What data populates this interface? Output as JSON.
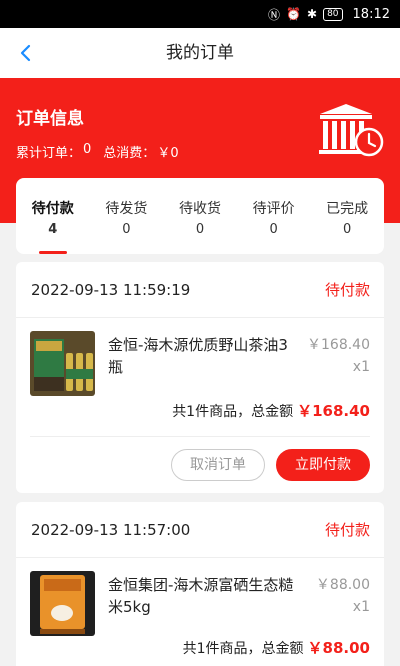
{
  "status_bar": {
    "battery": "80",
    "time": "18:12"
  },
  "nav": {
    "title": "我的订单"
  },
  "summary_header": {
    "title": "订单信息",
    "total_orders_label": "累计订单：",
    "total_orders_value": "0",
    "total_spend_label": "总消费：",
    "total_spend_value": "￥0"
  },
  "tabs": [
    {
      "label": "待付款",
      "count": "4",
      "active": true
    },
    {
      "label": "待发货",
      "count": "0",
      "active": false
    },
    {
      "label": "待收货",
      "count": "0",
      "active": false
    },
    {
      "label": "待评价",
      "count": "0",
      "active": false
    },
    {
      "label": "已完成",
      "count": "0",
      "active": false
    }
  ],
  "orders": [
    {
      "datetime": "2022-09-13 11:59:19",
      "status": "待付款",
      "product_name": "金恒-海木源优质野山茶油3瓶",
      "price": "￥168.40",
      "qty": "x1",
      "summary_text": "共1件商品，总金额",
      "total": "￥168.40",
      "cancel_label": "取消订单",
      "pay_label": "立即付款"
    },
    {
      "datetime": "2022-09-13 11:57:00",
      "status": "待付款",
      "product_name": "金恒集团-海木源富硒生态糙米5kg",
      "price": "￥88.00",
      "qty": "x1",
      "summary_text": "共1件商品，总金额",
      "total": "￥88.00"
    }
  ],
  "colors": {
    "accent": "#f3201a",
    "background": "#f2f2f2"
  }
}
